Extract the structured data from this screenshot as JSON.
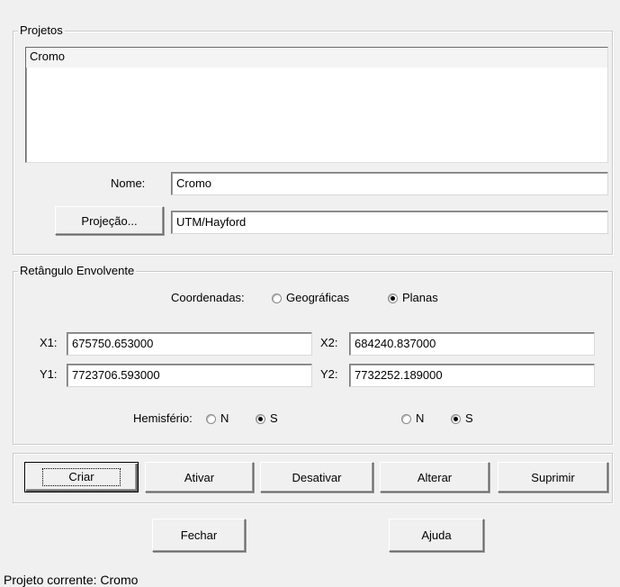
{
  "projetos": {
    "legend": "Projetos",
    "list_items": [
      "Cromo"
    ],
    "nome_label": "Nome:",
    "nome_value": "Cromo",
    "projecao_button": "Projeção...",
    "projecao_value": "UTM/Hayford"
  },
  "retangulo": {
    "legend": "Retângulo Envolvente",
    "coordenadas_label": "Coordenadas:",
    "opt_geograficas": "Geográficas",
    "opt_planas": "Planas",
    "selected_coord": "Planas",
    "x1_label": "X1:",
    "x1_value": "675750.653000",
    "x2_label": "X2:",
    "x2_value": "684240.837000",
    "y1_label": "Y1:",
    "y1_value": "7723706.593000",
    "y2_label": "Y2:",
    "y2_value": "7732252.189000",
    "hemisferio_label": "Hemisfério:",
    "hemi1": {
      "n": "N",
      "s": "S",
      "selected": "S"
    },
    "hemi2": {
      "n": "N",
      "s": "S",
      "selected": "S"
    }
  },
  "actions": {
    "criar": "Criar",
    "ativar": "Ativar",
    "desativar": "Desativar",
    "alterar": "Alterar",
    "suprimir": "Suprimir"
  },
  "footer": {
    "fechar": "Fechar",
    "ajuda": "Ajuda",
    "status": "Projeto corrente: Cromo"
  }
}
